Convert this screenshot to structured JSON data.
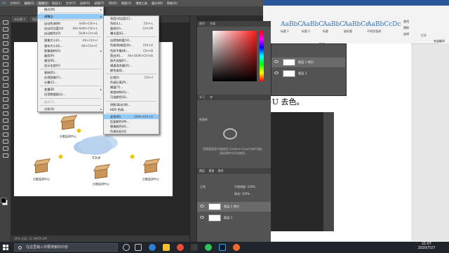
{
  "photoshop": {
    "menubar": [
      "文件(F)",
      "编辑(E)",
      "图像(I)",
      "图层(L)",
      "文字(Y)",
      "选择(S)",
      "滤镜(T)",
      "3D(D)",
      "视图(V)",
      "增效工具",
      "窗口(W)",
      "帮助(H)"
    ],
    "status": "16%    文档: 12.3M/25.0M",
    "tabs": [
      "未标题-1",
      "图层 1 拷贝"
    ],
    "image_menu": [
      {
        "label": "模式(M)",
        "sc": "",
        "sub": true
      },
      {
        "sep": true
      },
      {
        "label": "调整(J)",
        "sc": "",
        "sub": true,
        "hl": true
      },
      {
        "sep": true
      },
      {
        "label": "自动色调(N)",
        "sc": "Shift+Ctrl+L"
      },
      {
        "label": "自动对比度(U)",
        "sc": "Alt+Shift+Ctrl+L"
      },
      {
        "label": "自动颜色(O)",
        "sc": "Shift+Ctrl+B"
      },
      {
        "sep": true
      },
      {
        "label": "图像大小(I)...",
        "sc": "Alt+Ctrl+I"
      },
      {
        "label": "画布大小(S)...",
        "sc": "Alt+Ctrl+C"
      },
      {
        "label": "图像旋转(G)",
        "sc": "",
        "sub": true
      },
      {
        "label": "裁剪(P)",
        "sc": ""
      },
      {
        "label": "裁切(R)...",
        "sc": ""
      },
      {
        "label": "显示全部(V)",
        "sc": ""
      },
      {
        "sep": true
      },
      {
        "label": "复制(D)...",
        "sc": ""
      },
      {
        "label": "应用图像(Y)...",
        "sc": ""
      },
      {
        "label": "计算(C)...",
        "sc": ""
      },
      {
        "sep": true
      },
      {
        "label": "变量(B)",
        "sc": "",
        "sub": true
      },
      {
        "label": "应用数据组(L)...",
        "sc": ""
      },
      {
        "sep": true
      },
      {
        "label": "陷印(T)...",
        "sc": "",
        "dis": true
      },
      {
        "sep": true
      },
      {
        "label": "分析(A)",
        "sc": "",
        "sub": true
      }
    ],
    "adjust_menu": [
      {
        "label": "亮度/对比度(C)...",
        "sc": ""
      },
      {
        "label": "色阶(L)...",
        "sc": "Ctrl+L"
      },
      {
        "label": "曲线(U)...",
        "sc": "Ctrl+M"
      },
      {
        "label": "曝光度(E)...",
        "sc": ""
      },
      {
        "sep": true
      },
      {
        "label": "自然饱和度(V)...",
        "sc": ""
      },
      {
        "label": "色相/饱和度(H)...",
        "sc": "Ctrl+U"
      },
      {
        "label": "色彩平衡(B)...",
        "sc": "Ctrl+B"
      },
      {
        "label": "黑白(K)...",
        "sc": "Alt+Shift+Ctrl+B"
      },
      {
        "label": "照片滤镜(F)...",
        "sc": ""
      },
      {
        "label": "通道混合器(X)...",
        "sc": ""
      },
      {
        "label": "颜色查找...",
        "sc": ""
      },
      {
        "sep": true
      },
      {
        "label": "反相(I)",
        "sc": "Ctrl+I"
      },
      {
        "label": "色调分离(P)...",
        "sc": ""
      },
      {
        "label": "阈值(T)...",
        "sc": ""
      },
      {
        "label": "渐变映射(G)...",
        "sc": ""
      },
      {
        "label": "可选颜色(S)...",
        "sc": ""
      },
      {
        "sep": true
      },
      {
        "label": "阴影/高光(W)...",
        "sc": ""
      },
      {
        "label": "HDR 色调...",
        "sc": ""
      },
      {
        "sep": true
      },
      {
        "label": "去色(D)",
        "sc": "Shift+Ctrl+U",
        "hl": true
      },
      {
        "label": "匹配颜色(M)...",
        "sc": ""
      },
      {
        "label": "替换颜色(R)...",
        "sc": ""
      },
      {
        "label": "色调均化(Q)",
        "sc": ""
      }
    ],
    "diagram": {
      "labels": [
        "分散监测中心",
        "分散监测中心",
        "分散监测中心",
        "分散监测中心",
        "分散监测中心"
      ],
      "cloud_label": "TCP/IP"
    },
    "panels": {
      "color_tabs": [
        "颜色",
        "色板"
      ],
      "learn_tabs": [
        "学习",
        "库"
      ],
      "libs_title": "新建库",
      "cc_text": "您需要登录才能使用 Creative Cloud 协作功能。请创建库并开始使用。",
      "layers_tabs": [
        "图层",
        "通道",
        "路径"
      ],
      "blend": "正常",
      "opacity_label": "不透明度: 100%",
      "fill_label": "填充: 100%",
      "layers": [
        "图层 1 拷贝",
        "图层 1"
      ]
    },
    "colors": {
      "highlight": "#91c9f7",
      "panel": "#535353",
      "workspace": "#282828"
    }
  },
  "word": {
    "styles": [
      {
        "sample": "AaBbC",
        "name": "标题 1"
      },
      {
        "sample": "AaBbC",
        "name": "标题 2"
      },
      {
        "sample": "AaBbC",
        "name": "标题"
      },
      {
        "sample": "AaBbCc",
        "name": "副标题"
      },
      {
        "sample": "AaBbCcDc",
        "name": "不明显强调"
      }
    ],
    "styles_group": "样式",
    "side_buttons": [
      "查找",
      "替换",
      "选择",
      "打开",
      "有道翻译"
    ],
    "doc_text": "ft+U 去色。"
  },
  "taskbar": {
    "search_placeholder": "在这里输入你要搜索的内容",
    "time": "21:07",
    "date": "2020/7/27"
  }
}
